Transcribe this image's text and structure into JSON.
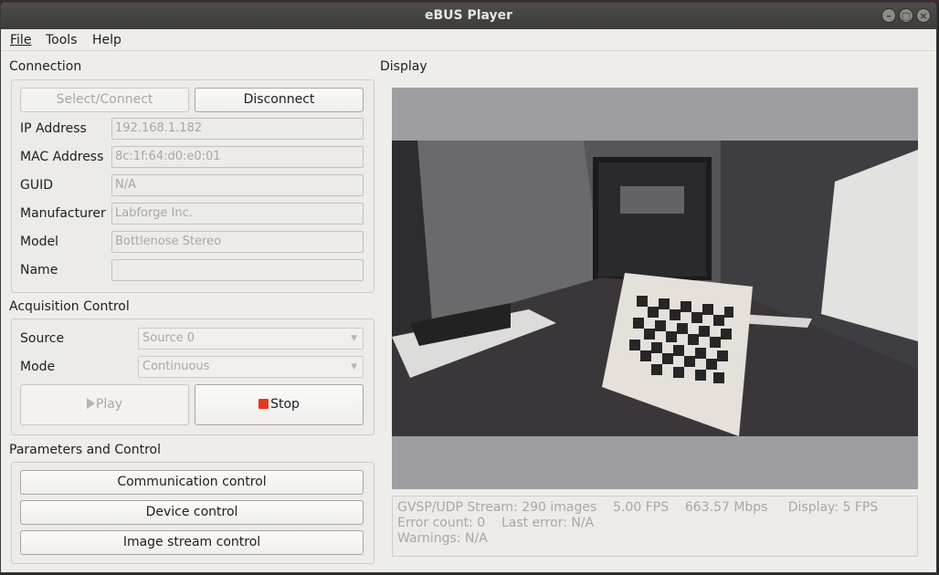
{
  "window": {
    "title": "eBUS Player"
  },
  "menu": {
    "file": "File",
    "tools": "Tools",
    "help": "Help"
  },
  "connection": {
    "title": "Connection",
    "select_connect": "Select/Connect",
    "disconnect": "Disconnect",
    "fields": [
      {
        "label": "IP Address",
        "value": "192.168.1.182"
      },
      {
        "label": "MAC Address",
        "value": "8c:1f:64:d0:e0:01"
      },
      {
        "label": "GUID",
        "value": "N/A"
      },
      {
        "label": "Manufacturer",
        "value": "Labforge Inc."
      },
      {
        "label": "Model",
        "value": "Bottlenose Stereo"
      },
      {
        "label": "Name",
        "value": ""
      }
    ]
  },
  "acquisition": {
    "title": "Acquisition Control",
    "source_label": "Source",
    "source_value": "Source 0",
    "mode_label": "Mode",
    "mode_value": "Continuous",
    "play": "Play",
    "stop": "Stop"
  },
  "parameters": {
    "title": "Parameters and Control",
    "communication": "Communication control",
    "device": "Device control",
    "image_stream": "Image stream control"
  },
  "display": {
    "title": "Display",
    "status_line1": "GVSP/UDP Stream: 290 images    5.00 FPS    663.57 Mbps     Display: 5 FPS",
    "status_line2": "Error count: 0    Last error: N/A",
    "status_line3": "Warnings: N/A"
  },
  "colors": {
    "stop_icon": "#e43a1c",
    "titlebar": "#3d3c39",
    "letterbox": "#9e9ea2"
  }
}
